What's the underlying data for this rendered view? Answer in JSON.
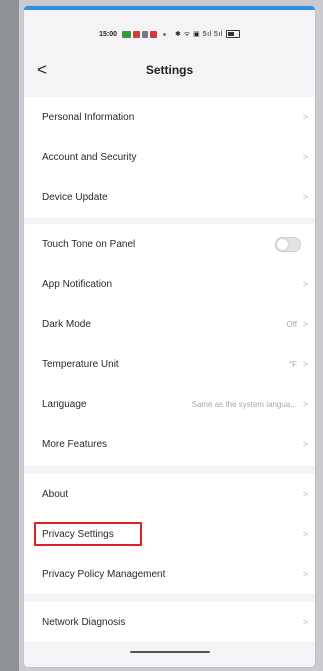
{
  "status_bar": {
    "time": "15:00",
    "right_text": "✱ ᯤ ▣ 5ıl 5ıl"
  },
  "header": {
    "back_label": "<",
    "title": "Settings"
  },
  "groups": [
    {
      "items": [
        {
          "label": "Personal Information",
          "value": "",
          "control": "chevron"
        },
        {
          "label": "Account and Security",
          "value": "",
          "control": "chevron"
        },
        {
          "label": "Device Update",
          "value": "",
          "control": "chevron"
        }
      ]
    },
    {
      "items": [
        {
          "label": "Touch Tone on Panel",
          "value": "",
          "control": "toggle",
          "toggle_on": false
        },
        {
          "label": "App Notification",
          "value": "",
          "control": "chevron"
        },
        {
          "label": "Dark Mode",
          "value": "Off",
          "control": "chevron"
        },
        {
          "label": "Temperature Unit",
          "value": "°F",
          "control": "chevron"
        },
        {
          "label": "Language",
          "value": "Same as the system langua...",
          "control": "chevron"
        },
        {
          "label": "More Features",
          "value": "",
          "control": "chevron"
        }
      ]
    },
    {
      "items": [
        {
          "label": "About",
          "value": "",
          "control": "chevron"
        },
        {
          "label": "Privacy Settings",
          "value": "",
          "control": "chevron",
          "highlighted": true
        },
        {
          "label": "Privacy Policy Management",
          "value": "",
          "control": "chevron"
        }
      ]
    },
    {
      "items": [
        {
          "label": "Network Diagnosis",
          "value": "",
          "control": "chevron"
        }
      ]
    }
  ],
  "chevron_glyph": ">",
  "colors": {
    "background": "#f4f4f6",
    "card": "#ffffff",
    "highlight_border": "#e0202a",
    "toggle_off": "#e2e2e2"
  }
}
